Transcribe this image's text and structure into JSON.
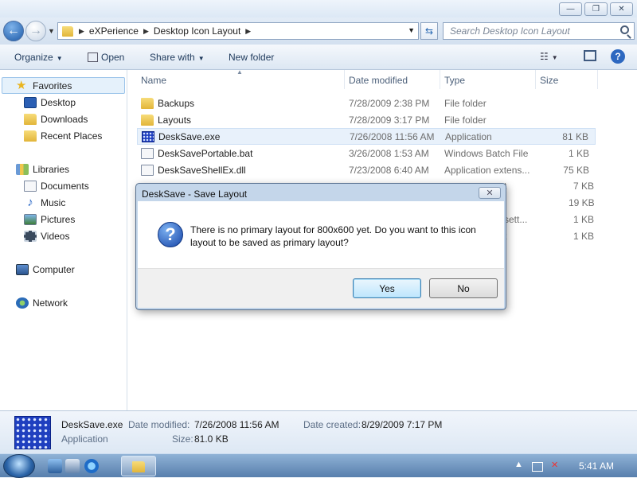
{
  "window": {
    "minimize_glyph": "—",
    "maximize_glyph": "❐",
    "close_glyph": "✕"
  },
  "address": {
    "crumbs": [
      "eXPerience",
      "Desktop Icon Layout"
    ],
    "search_placeholder": "Search Desktop Icon Layout"
  },
  "toolbar": {
    "organize": "Organize",
    "open": "Open",
    "share_with": "Share with",
    "new_folder": "New folder"
  },
  "nav": {
    "favorites": "Favorites",
    "desktop": "Desktop",
    "downloads": "Downloads",
    "recent_places": "Recent Places",
    "libraries": "Libraries",
    "documents": "Documents",
    "music": "Music",
    "pictures": "Pictures",
    "videos": "Videos",
    "computer": "Computer",
    "network": "Network"
  },
  "columns": {
    "name": "Name",
    "date_modified": "Date modified",
    "type": "Type",
    "size": "Size"
  },
  "files": [
    {
      "name": "Backups",
      "date": "7/28/2009 2:38 PM",
      "type": "File folder",
      "size": "",
      "icon": "folder-icon"
    },
    {
      "name": "Layouts",
      "date": "7/28/2009 3:17 PM",
      "type": "File folder",
      "size": "",
      "icon": "folder-icon"
    },
    {
      "name": "DeskSave.exe",
      "date": "7/26/2008 11:56 AM",
      "type": "Application",
      "size": "81 KB",
      "icon": "application-icon"
    },
    {
      "name": "DeskSavePortable.bat",
      "date": "3/26/2008 1:53 AM",
      "type": "Windows Batch File",
      "size": "1 KB",
      "icon": "batch-file-icon"
    },
    {
      "name": "DeskSaveShellEx.dll",
      "date": "7/23/2008 6:40 AM",
      "type": "Application extens...",
      "size": "75 KB",
      "icon": "dll-file-icon"
    }
  ],
  "hidden_rows": {
    "type_fragments": [
      "t",
      "sett...",
      "t"
    ],
    "sizes": [
      "7 KB",
      "19 KB",
      "1 KB",
      "1 KB"
    ]
  },
  "dialog": {
    "title": "DeskSave - Save Layout",
    "message": "There is no primary layout for 800x600 yet. Do you want to this icon layout to be saved as primary layout?",
    "yes": "Yes",
    "no": "No",
    "close_glyph": "✕",
    "icon_glyph": "?"
  },
  "details": {
    "name": "DeskSave.exe",
    "type": "Application",
    "date_modified_label": "Date modified:",
    "date_modified": "7/26/2008 11:56 AM",
    "size_label": "Size:",
    "size": "81.0 KB",
    "date_created_label": "Date created:",
    "date_created": "8/29/2009 7:17 PM"
  },
  "taskbar": {
    "clock": "5:41 AM"
  }
}
